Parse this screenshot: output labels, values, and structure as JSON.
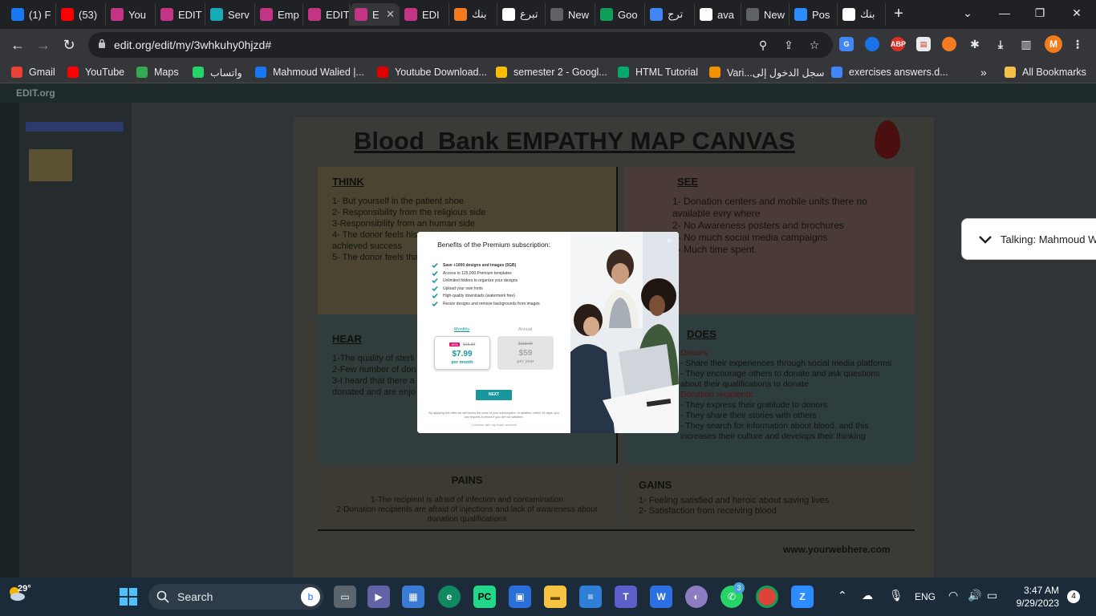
{
  "tabs": [
    {
      "label": "(1) F",
      "icon": "facebook-icon",
      "color": "#1877f2"
    },
    {
      "label": "(53)",
      "icon": "youtube-icon",
      "color": "#ff0000"
    },
    {
      "label": "You",
      "icon": "edit-org-icon",
      "color": "#c13584"
    },
    {
      "label": "EDIT",
      "icon": "edit-org-icon",
      "color": "#c13584"
    },
    {
      "label": "Serv",
      "icon": "edit-icon",
      "color": "#17a9b5"
    },
    {
      "label": "Emp",
      "icon": "edit-org-icon",
      "color": "#c13584"
    },
    {
      "label": "EDIT",
      "icon": "edit-org-icon",
      "color": "#c13584"
    },
    {
      "label": "E",
      "icon": "edit-org-icon",
      "color": "#c13584",
      "active": true
    },
    {
      "label": "EDI",
      "icon": "edit-org-icon",
      "color": "#c13584"
    },
    {
      "label": "بنك",
      "icon": "orange-app-icon",
      "color": "#f47b20"
    },
    {
      "label": "تبرع",
      "icon": "wikipedia-icon",
      "color": "#ffffff"
    },
    {
      "label": "New",
      "icon": "chrome-icon",
      "color": "#5f6368"
    },
    {
      "label": "Goo",
      "icon": "classroom-icon",
      "color": "#0f9d58"
    },
    {
      "label": "ترج",
      "icon": "translate-icon",
      "color": "#4285f4"
    },
    {
      "label": "ava",
      "icon": "google-icon",
      "color": "#ffffff"
    },
    {
      "label": "New",
      "icon": "chrome-icon",
      "color": "#5f6368"
    },
    {
      "label": "Pos",
      "icon": "zoom-icon",
      "color": "#2d8cff"
    },
    {
      "label": "بنك",
      "icon": "google-icon",
      "color": "#ffffff"
    }
  ],
  "address": {
    "url": "edit.org/edit/my/3whkuhy0hjzd#"
  },
  "profile_initial": "M",
  "bookmarks": [
    {
      "label": "Gmail",
      "color": "#ea4335"
    },
    {
      "label": "YouTube",
      "color": "#ff0000"
    },
    {
      "label": "Maps",
      "color": "#34a853"
    },
    {
      "label": "واتساب",
      "color": "#25d366"
    },
    {
      "label": "Mahmoud Walied |...",
      "color": "#1877f2"
    },
    {
      "label": "Youtube Download...",
      "color": "#e00000"
    },
    {
      "label": "semester 2 - Googl...",
      "color": "#fbbc04"
    },
    {
      "label": "HTML Tutorial",
      "color": "#04aa6d"
    },
    {
      "label": "Vari...سجل الدخول إلى",
      "color": "#f29200"
    },
    {
      "label": "exercises answers.d...",
      "color": "#4285f4"
    }
  ],
  "all_bookmarks": "All Bookmarks",
  "editor": {
    "logo": "EDIT.org"
  },
  "canvas": {
    "title": "Blood_Bank EMPATHY MAP CANVAS",
    "think": {
      "heading": "THINK",
      "lines": [
        "1- But yourself in the patient shoe",
        "2- Responsibility from the religious side",
        "3-Responsibility from an human side",
        "4- The donor feels his",
        "achieved success",
        "5- The donor feels tha"
      ]
    },
    "see": {
      "heading": "SEE",
      "lines": [
        "1- Donation centers and mobile units there no",
        "available evry where",
        "2- No Awareness posters and brochures",
        "3- No much social media campaigns",
        "4- Much time spent"
      ]
    },
    "hear": {
      "heading": "HEAR",
      "lines": [
        "1-The quality of sterli",
        "2-Few number of don",
        "3-I heard that there a",
        "donated and are enjo"
      ]
    },
    "does": {
      "heading": "DOES",
      "donors": "Donors:",
      "lines1": [
        "- Share their experiences through social media platforms",
        "- They encourage others to donate and ask questions",
        "about their qualifications to donate"
      ],
      "recipients": "Donation recipients:",
      "lines2": [
        "- They express their gratitude to donors",
        "- They share their stories with others",
        "- They search for information about blood, and this",
        "increases their culture and develops their thinking"
      ]
    },
    "pains": {
      "heading": "PAINS",
      "lines": [
        "1-The recipient is afraid of infection and contamination",
        "2-Donation recipients are afraid of injections and lack of awareness about",
        "donation qualifications"
      ]
    },
    "gains": {
      "heading": "GAINS",
      "lines": [
        "1- Feeling satisfied and heroic about saving lives",
        "2- Satisfaction from receiving blood"
      ]
    },
    "website": "www.yourwebhere.com"
  },
  "modal": {
    "title": "Benefits of the Premium subscription:",
    "benefits": [
      "Save +1000 designs and images (5GB)",
      "Access to 125,000 Premium templates",
      "Unlimited folders to organize your designs",
      "Upload your own fonts",
      "High-quality downloads (watermark free)",
      "Resize designs and remove backgrounds from images"
    ],
    "monthly_tab": "Monthly",
    "annual_tab": "Annual",
    "monthly": {
      "badge": "-50%",
      "old": "$15.99",
      "price": "$7.99",
      "per": "per month"
    },
    "annual": {
      "old": "$118.99",
      "price": "$59",
      "per": "per year"
    },
    "next": "NEXT",
    "fine_print": "By applying this offer we will renew the price of your subscription. In addition, within 15 days, you can request a refund if you are not satisfied.",
    "continue": "Continue with my basic account",
    "close": "×"
  },
  "talking": "Talking: Mahmoud W",
  "taskbar": {
    "weather": "29°",
    "search_placeholder": "Search",
    "lang": "ENG",
    "time": "3:47 AM",
    "date": "9/29/2023",
    "notif_count": "4",
    "whatsapp_badge": "3"
  },
  "colors": {
    "accent": "#17969b",
    "badge": "#e2146f"
  }
}
